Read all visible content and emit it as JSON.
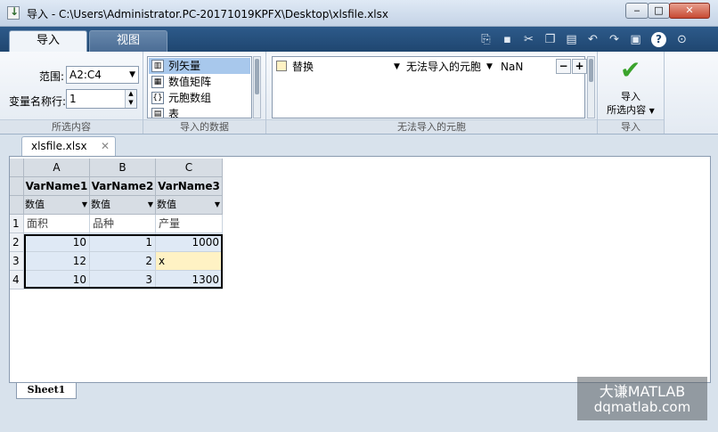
{
  "window": {
    "title": "导入 - C:\\Users\\Administrator.PC-20171019KPFX\\Desktop\\xlsfile.xlsx",
    "minimize_icon": "minimize-icon",
    "maximize_icon": "maximize-icon",
    "close_icon": "close-icon"
  },
  "ribbon_tabs": [
    {
      "label": "导入",
      "active": true
    },
    {
      "label": "视图",
      "active": false
    }
  ],
  "toolbar_icons": [
    "import-file-icon",
    "save-icon",
    "cut-icon",
    "copy-icon",
    "paste-icon",
    "undo-icon",
    "redo-icon",
    "switch-windows-icon",
    "help-icon",
    "more-options-icon"
  ],
  "selection_section": {
    "range_label": "范围:",
    "range_value": "A2:C4",
    "varnames_label": "变量名称行:",
    "varnames_value": "1",
    "footer": "所选内容"
  },
  "imported_data_section": {
    "types": [
      {
        "label": "列矢量",
        "selected": true
      },
      {
        "label": "数值矩阵",
        "selected": false
      },
      {
        "label": "元胞数组",
        "selected": false
      },
      {
        "label": "表",
        "selected": false
      }
    ],
    "footer": "导入的数据"
  },
  "unimportable_section": {
    "rule_action": "替换",
    "rule_target": "无法导入的元胞",
    "rule_value": "NaN",
    "remove_rule": "−",
    "add_rule": "+",
    "footer": "无法导入的元胞"
  },
  "import_section": {
    "button_line1": "导入",
    "button_line2": "所选内容",
    "footer": "导入"
  },
  "file_tab": {
    "label": "xlsfile.xlsx",
    "close": "✕"
  },
  "grid": {
    "columns": [
      {
        "letter": "A",
        "varname": "VarName1",
        "type": "数值"
      },
      {
        "letter": "B",
        "varname": "VarName2",
        "type": "数值"
      },
      {
        "letter": "C",
        "varname": "VarName3",
        "type": "数值"
      }
    ],
    "rows": [
      {
        "num": "1",
        "cells": [
          "面积",
          "品种",
          "产量"
        ]
      },
      {
        "num": "2",
        "cells": [
          "10",
          "1",
          "1000"
        ]
      },
      {
        "num": "3",
        "cells": [
          "12",
          "2",
          "x"
        ]
      },
      {
        "num": "4",
        "cells": [
          "10",
          "3",
          "1300"
        ]
      }
    ]
  },
  "sheet_tab": "Sheet1",
  "watermark": {
    "line1": "大谦MATLAB",
    "line2": "dqmatlab.com"
  },
  "colors": {
    "ribbon_dark": "#1f4670",
    "selection_fill": "#dfe9f5",
    "unimportable_fill": "#fff2c4",
    "accent_check": "#3aa32c"
  }
}
